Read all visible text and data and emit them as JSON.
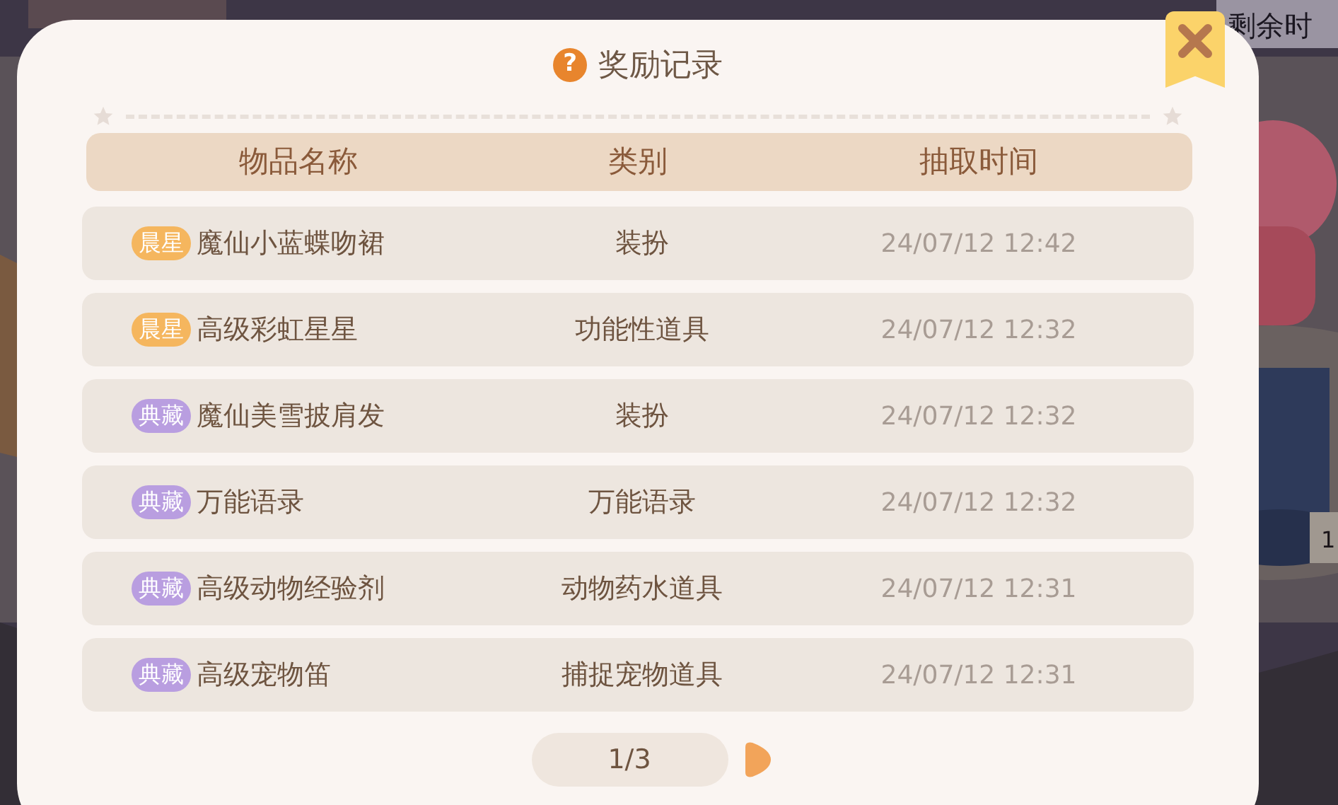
{
  "background": {
    "corner_text": "剩余时",
    "side_text": "1"
  },
  "dialog": {
    "help_glyph": "?",
    "title": "奖励记录",
    "columns": [
      "物品名称",
      "类别",
      "抽取时间"
    ],
    "rows": [
      {
        "badge": {
          "text": "晨星",
          "color": "#f5b65e"
        },
        "name": "魔仙小蓝蝶吻裙",
        "category": "装扮",
        "time": "24/07/12 12:42"
      },
      {
        "badge": {
          "text": "晨星",
          "color": "#f5b65e"
        },
        "name": "高级彩虹星星",
        "category": "功能性道具",
        "time": "24/07/12 12:32"
      },
      {
        "badge": {
          "text": "典藏",
          "color": "#b99ee0"
        },
        "name": "魔仙美雪披肩发",
        "category": "装扮",
        "time": "24/07/12 12:32"
      },
      {
        "badge": {
          "text": "典藏",
          "color": "#b99ee0"
        },
        "name": "万能语录",
        "category": "万能语录",
        "time": "24/07/12 12:32"
      },
      {
        "badge": {
          "text": "典藏",
          "color": "#b99ee0"
        },
        "name": "高级动物经验剂",
        "category": "动物药水道具",
        "time": "24/07/12 12:31"
      },
      {
        "badge": {
          "text": "典藏",
          "color": "#b99ee0"
        },
        "name": "高级宠物笛",
        "category": "捕捉宠物道具",
        "time": "24/07/12 12:31"
      }
    ],
    "pagination": {
      "page": "1/3"
    }
  }
}
